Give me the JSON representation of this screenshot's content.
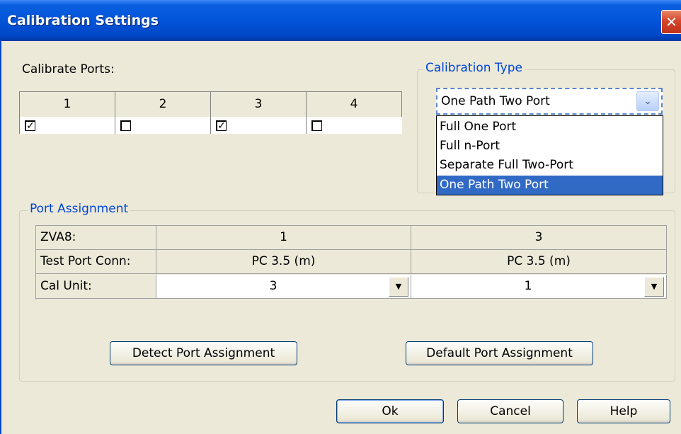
{
  "window": {
    "title": "Calibration Settings",
    "close_label": "✕"
  },
  "calibrate_ports": {
    "label": "Calibrate Ports:",
    "ports": [
      {
        "number": "1",
        "checked": true,
        "mark": "✓"
      },
      {
        "number": "2",
        "checked": false,
        "mark": ""
      },
      {
        "number": "3",
        "checked": true,
        "mark": "✓"
      },
      {
        "number": "4",
        "checked": false,
        "mark": ""
      }
    ]
  },
  "calibration_type": {
    "group_title": "Calibration Type",
    "selected": "One Path Two Port",
    "arrow": "⌄",
    "options": [
      "Full One Port",
      "Full n-Port",
      "Separate Full Two-Port",
      "One Path Two Port"
    ],
    "highlighted_index": 3
  },
  "port_assignment": {
    "group_title": "Port Assignment",
    "rows": [
      {
        "label": "ZVA8:",
        "values": [
          "1",
          "3"
        ]
      },
      {
        "label": "Test Port Conn:",
        "values": [
          "PC 3.5 (m)",
          "PC 3.5 (m)"
        ]
      },
      {
        "label": "Cal Unit:",
        "values": [
          "3",
          "1"
        ]
      }
    ],
    "dropdown_arrow": "▼",
    "detect_button": "Detect Port Assignment",
    "default_button": "Default Port Assignment"
  },
  "footer": {
    "ok": "Ok",
    "cancel": "Cancel",
    "help": "Help"
  },
  "colors": {
    "title_bar": "#0254d8",
    "group_title": "#0046d5",
    "highlight": "#316ac5",
    "dialog_bg": "#ece9d8"
  }
}
